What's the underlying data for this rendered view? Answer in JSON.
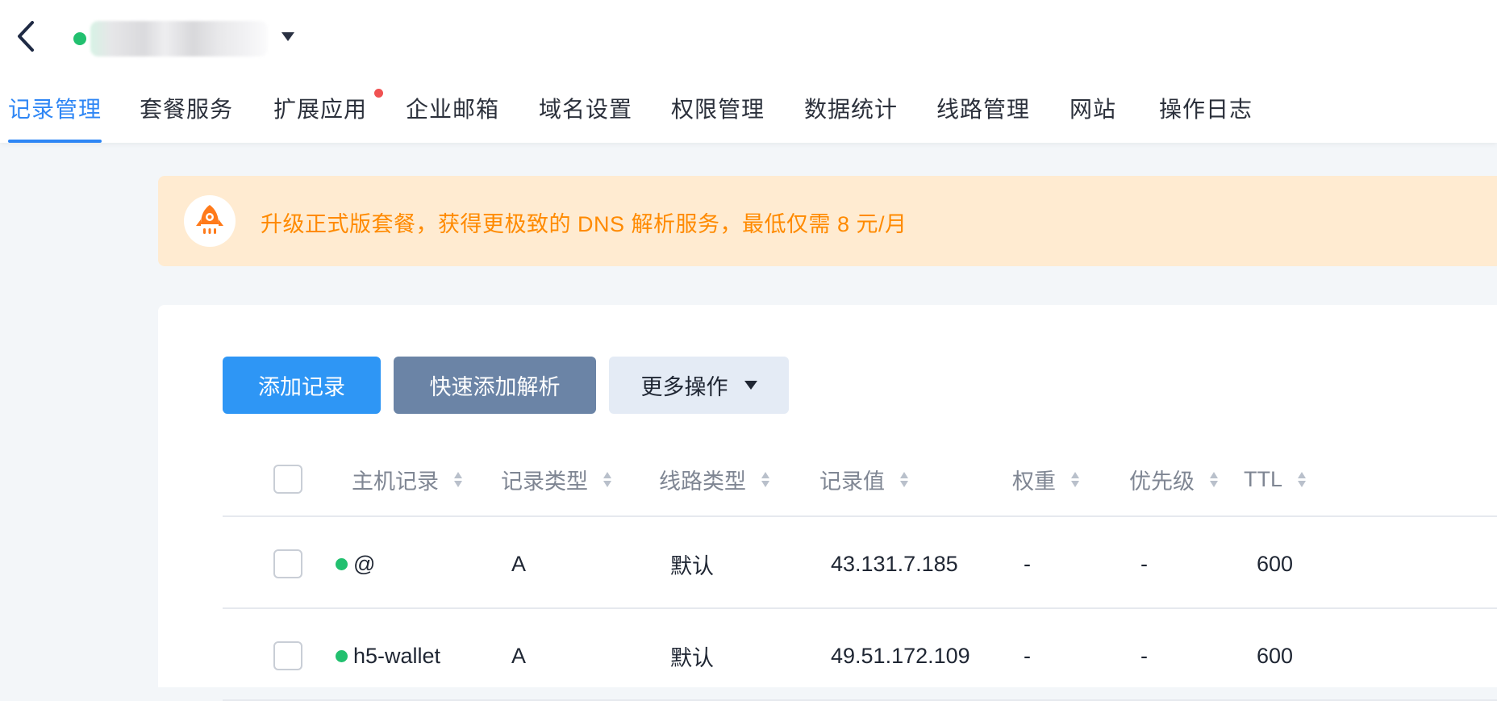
{
  "header": {
    "back_icon": "chevron-left-icon",
    "status_color": "#22c06f",
    "dropdown_icon": "caret-down-icon"
  },
  "tabs": [
    {
      "label": "记录管理",
      "active": true
    },
    {
      "label": "套餐服务"
    },
    {
      "label": "扩展应用",
      "badge": true
    },
    {
      "label": "企业邮箱"
    },
    {
      "label": "域名设置"
    },
    {
      "label": "权限管理"
    },
    {
      "label": "数据统计"
    },
    {
      "label": "线路管理"
    },
    {
      "label": "网站"
    },
    {
      "label": "操作日志"
    }
  ],
  "banner": {
    "icon": "rocket-icon",
    "text": "升级正式版套餐，获得更极致的 DNS 解析服务，最低仅需 8 元/月"
  },
  "toolbar": {
    "add_record": "添加记录",
    "quick_add": "快速添加解析",
    "more_actions": "更多操作"
  },
  "table": {
    "columns": [
      "主机记录",
      "记录类型",
      "线路类型",
      "记录值",
      "权重",
      "优先级",
      "TTL"
    ],
    "rows": [
      {
        "host": "@",
        "type": "A",
        "line": "默认",
        "value": "43.131.7.185",
        "weight": "-",
        "priority": "-",
        "ttl": "600"
      },
      {
        "host": "h5-wallet",
        "type": "A",
        "line": "默认",
        "value": "49.51.172.109",
        "weight": "-",
        "priority": "-",
        "ttl": "600"
      }
    ]
  },
  "colors": {
    "accent": "#2e86f5",
    "primary_button": "#2e96f5",
    "secondary_button": "#6b84a6",
    "banner_bg": "#ffebd1",
    "banner_text": "#ff8a00",
    "status_on": "#22c06f",
    "badge": "#f05252"
  }
}
